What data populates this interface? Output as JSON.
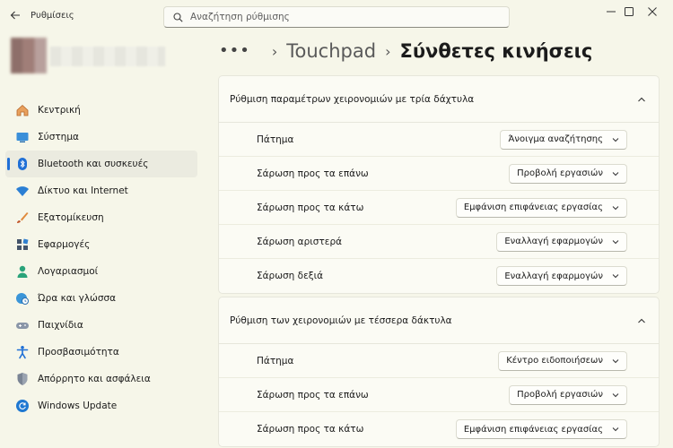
{
  "window": {
    "title": "Ρυθμίσεις",
    "search_placeholder": "Αναζήτηση ρύθμισης"
  },
  "sidebar": {
    "items": [
      {
        "label": "Κεντρική",
        "icon": "home-icon"
      },
      {
        "label": "Σύστημα",
        "icon": "monitor-icon"
      },
      {
        "label": "Bluetooth και συσκευές",
        "icon": "bluetooth-icon",
        "active": true
      },
      {
        "label": "Δίκτυο και Internet",
        "icon": "wifi-icon"
      },
      {
        "label": "Εξατομίκευση",
        "icon": "brush-icon"
      },
      {
        "label": "Εφαρμογές",
        "icon": "apps-icon"
      },
      {
        "label": "Λογαριασμοί",
        "icon": "person-icon"
      },
      {
        "label": "Ώρα και γλώσσα",
        "icon": "globe-clock-icon"
      },
      {
        "label": "Παιχνίδια",
        "icon": "gamepad-icon"
      },
      {
        "label": "Προσβασιμότητα",
        "icon": "accessibility-icon"
      },
      {
        "label": "Απόρρητο και ασφάλεια",
        "icon": "shield-icon"
      },
      {
        "label": "Windows Update",
        "icon": "update-icon"
      }
    ]
  },
  "breadcrumb": {
    "dots": "•••",
    "parent": "Touchpad",
    "current": "Σύνθετες κινήσεις"
  },
  "sections": [
    {
      "title": "Ρύθμιση παραμέτρων χειρονομιών με τρία δάχτυλα",
      "rows": [
        {
          "label": "Πάτημα",
          "value": "Άνοιγμα αναζήτησης"
        },
        {
          "label": "Σάρωση προς τα επάνω",
          "value": "Προβολή εργασιών"
        },
        {
          "label": "Σάρωση προς τα κάτω",
          "value": "Εμφάνιση επιφάνειας εργασίας"
        },
        {
          "label": "Σάρωση αριστερά",
          "value": "Εναλλαγή εφαρμογών"
        },
        {
          "label": "Σάρωση δεξιά",
          "value": "Εναλλαγή εφαρμογών"
        }
      ]
    },
    {
      "title": "Ρύθμιση των χειρονομιών με τέσσερα δάκτυλα",
      "rows": [
        {
          "label": "Πάτημα",
          "value": "Κέντρο ειδοποιήσεων"
        },
        {
          "label": "Σάρωση προς τα επάνω",
          "value": "Προβολή εργασιών"
        },
        {
          "label": "Σάρωση προς τα κάτω",
          "value": "Εμφάνιση επιφάνειας εργασίας"
        }
      ]
    }
  ],
  "colors": {
    "accent": "#1f6fd6",
    "background": "#f6f6e9"
  }
}
